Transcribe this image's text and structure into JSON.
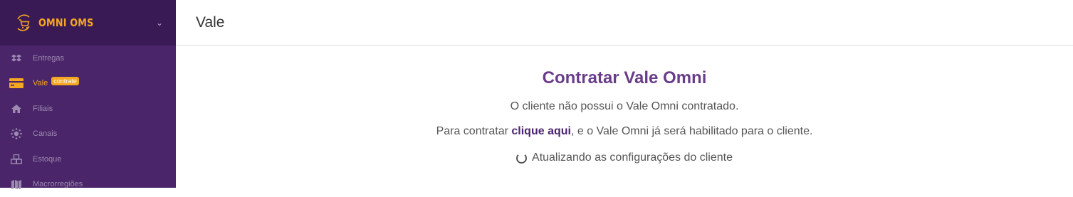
{
  "sidebar": {
    "brand": {
      "name": "OMNI OMS",
      "logo_icon": "cart-refresh-icon",
      "toggle_icon": "chevron-down-icon"
    },
    "items": [
      {
        "label": "Entregas",
        "icon": "dropbox-icon"
      },
      {
        "label": "Vale",
        "icon": "credit-card-icon",
        "badge": "contrate",
        "active": true
      },
      {
        "label": "Filiais",
        "icon": "home-icon"
      },
      {
        "label": "Canais",
        "icon": "sun-dots-icon"
      },
      {
        "label": "Estoque",
        "icon": "cubes-icon"
      },
      {
        "label": "Macrorregiões",
        "icon": "map-icon"
      }
    ]
  },
  "header": {
    "title": "Vale"
  },
  "main": {
    "heading": "Contratar Vale Omni",
    "info": "O cliente não possui o Vale Omni contratado.",
    "cta_prefix": "Para contratar ",
    "cta_link": "clique aqui",
    "cta_suffix": ", e o Vale Omni já será habilitado para o cliente.",
    "status": "Atualizando as configurações do cliente"
  },
  "colors": {
    "sidebar_bg": "#4a2569",
    "brand_bg": "#3a1a55",
    "accent": "#f5a623",
    "heading": "#6a3d8a"
  }
}
